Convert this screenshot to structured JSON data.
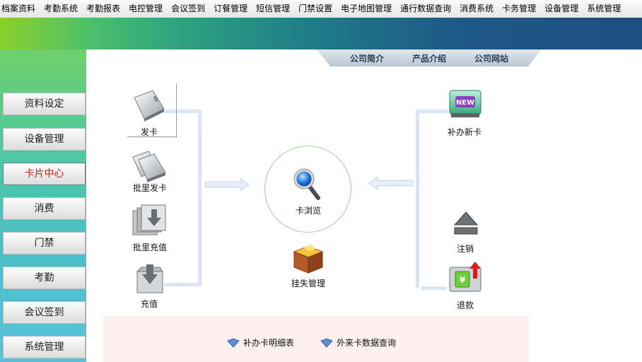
{
  "menu": [
    "档案资料",
    "考勤系统",
    "考勤报表",
    "电控管理",
    "会议签到",
    "订餐管理",
    "短信管理",
    "门禁设置",
    "电子地图管理",
    "通行数据查询",
    "消费系统",
    "卡务管理",
    "设备管理",
    "系统管理"
  ],
  "topnav": {
    "company_intro": "公司简介",
    "product_intro": "产品介绍",
    "company_site": "公司网站"
  },
  "sidebar": [
    {
      "label": "资料设定",
      "active": false
    },
    {
      "label": "设备管理",
      "active": false
    },
    {
      "label": "卡片中心",
      "active": true
    },
    {
      "label": "消费",
      "active": false
    },
    {
      "label": "门禁",
      "active": false
    },
    {
      "label": "考勤",
      "active": false
    },
    {
      "label": "会议签到",
      "active": false
    },
    {
      "label": "系统管理",
      "active": false
    }
  ],
  "flow": {
    "issue_card": "发卡",
    "batch_issue": "批里发卡",
    "batch_recharge": "批里充值",
    "recharge": "充值",
    "browse": "卡浏览",
    "loss_manage": "挂失管理",
    "reissue": "补办新卡",
    "cancel": "注销",
    "refund": "退款"
  },
  "bottom_links": {
    "reissue_detail": "补办卡明细表",
    "external_query": "外来卡数据查询"
  },
  "colors": {
    "active_text": "#d31b1b",
    "accent": "#1e4f82"
  }
}
